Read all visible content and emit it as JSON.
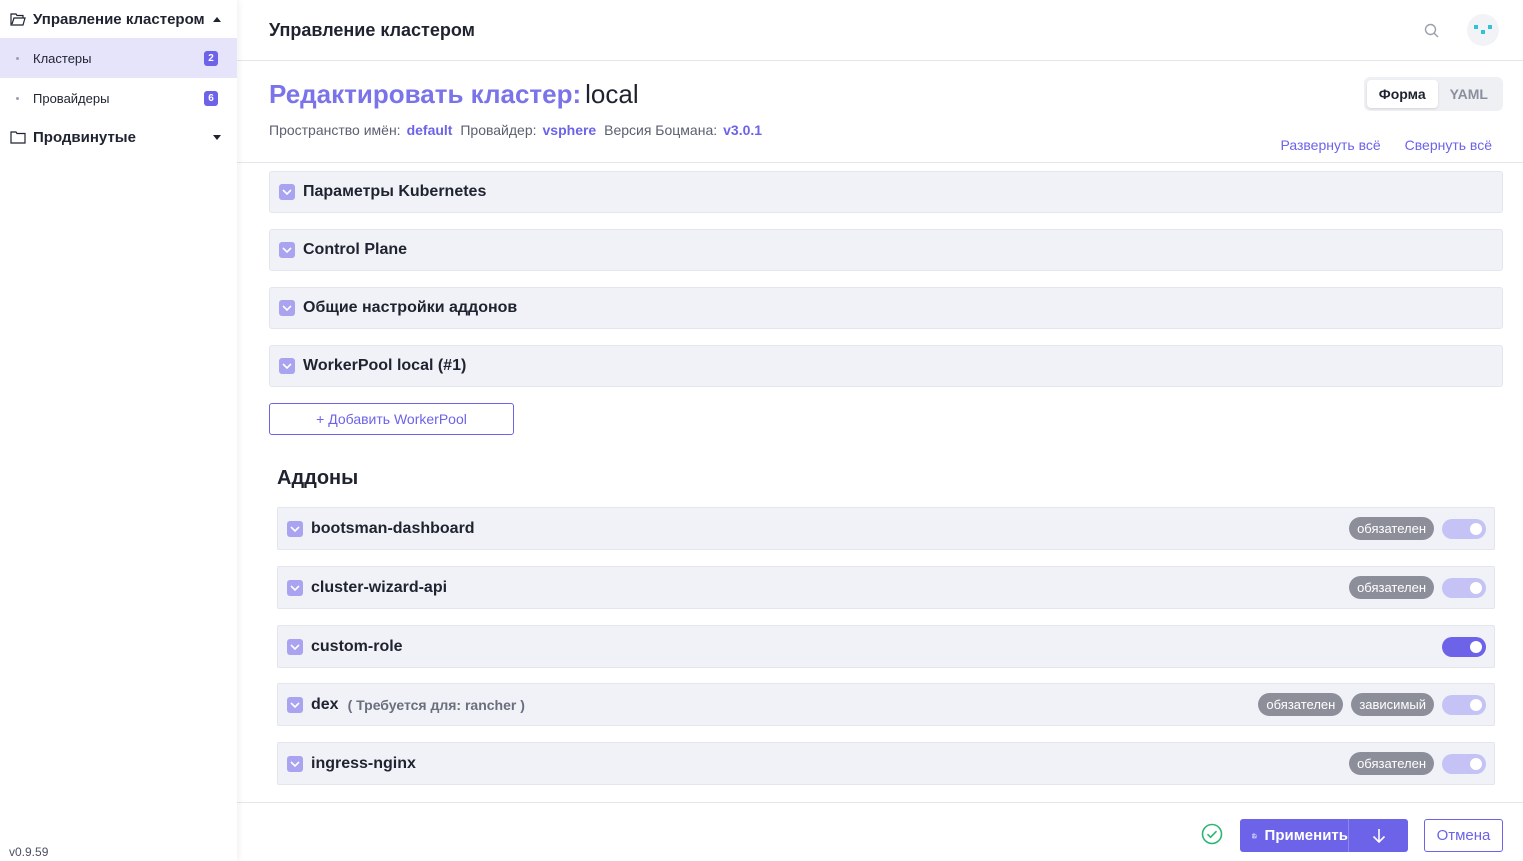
{
  "sidebar": {
    "group_main": {
      "label": "Управление кластером",
      "icon": "folder-open-icon"
    },
    "items": [
      {
        "label": "Кластеры",
        "count": "2",
        "active": true
      },
      {
        "label": "Провайдеры",
        "count": "6",
        "active": false
      }
    ],
    "group_advanced": {
      "label": "Продвинутые",
      "icon": "folder-icon"
    },
    "version": "v0.9.59"
  },
  "header": {
    "title": "Управление кластером",
    "search_icon": "search-icon",
    "avatar_icon": "avatar-icon"
  },
  "page": {
    "title_prefix": "Редактировать кластер:",
    "title_name": "local",
    "meta": {
      "namespace_label": "Пространство имён:",
      "namespace_value": "default",
      "provider_label": "Провайдер:",
      "provider_value": "vsphere",
      "version_label": "Версия Боцмана:",
      "version_value": "v3.0.1"
    },
    "view_modes": [
      "Форма",
      "YAML"
    ],
    "selected_mode": "Форма",
    "expand_all": "Развернуть всё",
    "collapse_all": "Свернуть всё"
  },
  "sections": [
    "Параметры Kubernetes",
    "Control Plane",
    "Общие настройки аддонов",
    "WorkerPool local (#1)"
  ],
  "add_workerpool": "+ Добавить WorkerPool",
  "addons": {
    "title": "Аддоны",
    "items": [
      {
        "name": "bootsman-dashboard",
        "requires": "",
        "badges": [
          "обязателен"
        ],
        "enabled": true,
        "locked": true
      },
      {
        "name": "cluster-wizard-api",
        "requires": "",
        "badges": [
          "обязателен"
        ],
        "enabled": true,
        "locked": true
      },
      {
        "name": "custom-role",
        "requires": "",
        "badges": [],
        "enabled": true,
        "locked": false
      },
      {
        "name": "dex",
        "requires": "( Требуется для: rancher )",
        "badges": [
          "обязателен",
          "зависимый"
        ],
        "enabled": true,
        "locked": true
      },
      {
        "name": "ingress-nginx",
        "requires": "",
        "badges": [
          "обязателен"
        ],
        "enabled": true,
        "locked": true
      }
    ]
  },
  "footer": {
    "apply_label": "Применить",
    "cancel_label": "Отмена",
    "valid_icon": "check-circle-icon"
  },
  "colors": {
    "accent": "#6c63e8",
    "accent_light": "#c5c2f5",
    "valid": "#2bb673",
    "badge": "#8c8f9a"
  }
}
